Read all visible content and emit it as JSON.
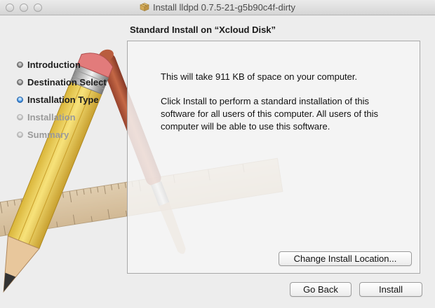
{
  "window": {
    "title": "Install lldpd 0.7.5-21-g5b90c4f-dirty"
  },
  "subtitle": "Standard Install on “Xcloud Disk”",
  "steps": [
    {
      "label": "Introduction",
      "state": "done"
    },
    {
      "label": "Destination Select",
      "state": "done"
    },
    {
      "label": "Installation Type",
      "state": "current"
    },
    {
      "label": "Installation",
      "state": "future"
    },
    {
      "label": "Summary",
      "state": "future"
    }
  ],
  "content": {
    "space_text": "This will take 911 KB of space on your computer.",
    "description": "Click Install to perform a standard installation of this software for all users of this computer. All users of this computer will be able to use this software."
  },
  "buttons": {
    "change_location": "Change Install Location...",
    "go_back": "Go Back",
    "install": "Install"
  },
  "icons": {
    "window": "package-icon",
    "background": "pencil-brush-ruler-art"
  },
  "colors": {
    "active_step": "#3d8fe0",
    "window_bg": "#ededed"
  }
}
